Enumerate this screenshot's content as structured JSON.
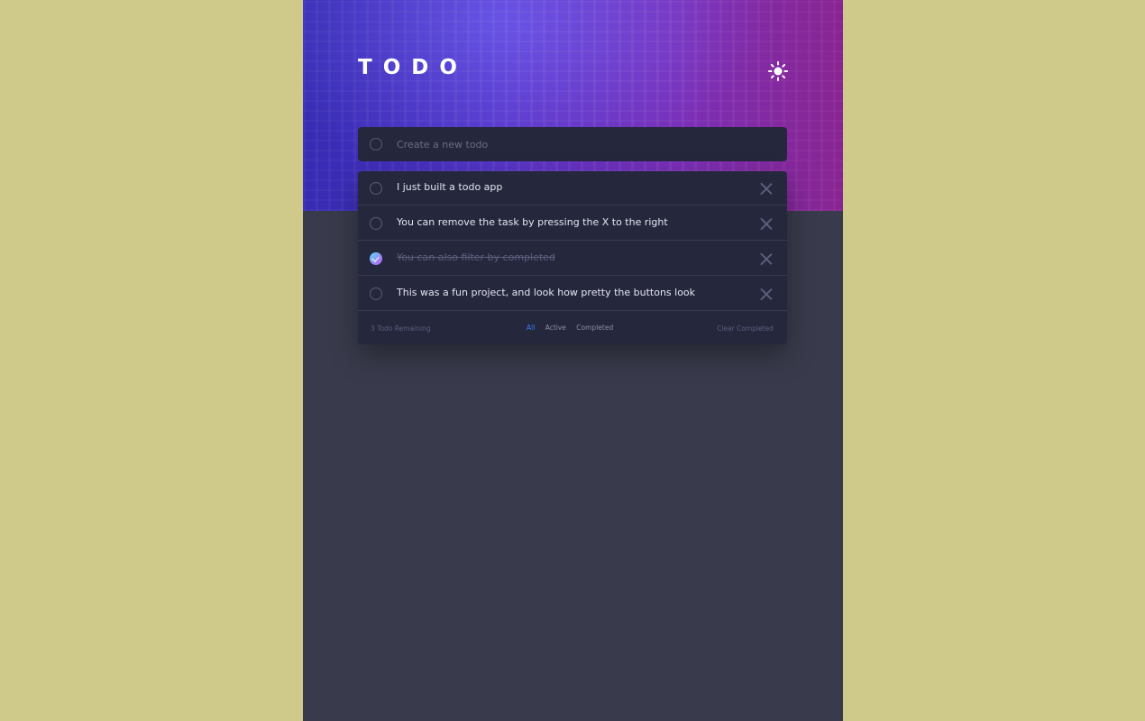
{
  "header": {
    "title": "TODO",
    "theme_toggle_icon": "sun-icon"
  },
  "new_todo": {
    "placeholder": "Create a new todo"
  },
  "todos": [
    {
      "text": "I just built a todo app",
      "completed": false
    },
    {
      "text": "You can remove the task by pressing the X to the right",
      "completed": false
    },
    {
      "text": "You can also filter by completed",
      "completed": true
    },
    {
      "text": "This was a fun project, and look how pretty the buttons look",
      "completed": false
    }
  ],
  "footer": {
    "remaining": "3 Todo Remaining",
    "filters": [
      "All",
      "Active",
      "Completed"
    ],
    "active_filter": "All",
    "clear_label": "Clear Completed"
  },
  "colors": {
    "page_background": "#cfca8a",
    "app_background": "#393b4c",
    "card": "#25273c",
    "accent_blue": "#3a7bfd",
    "check_gradient_start": "#57ddff",
    "check_gradient_end": "#c058f3"
  }
}
